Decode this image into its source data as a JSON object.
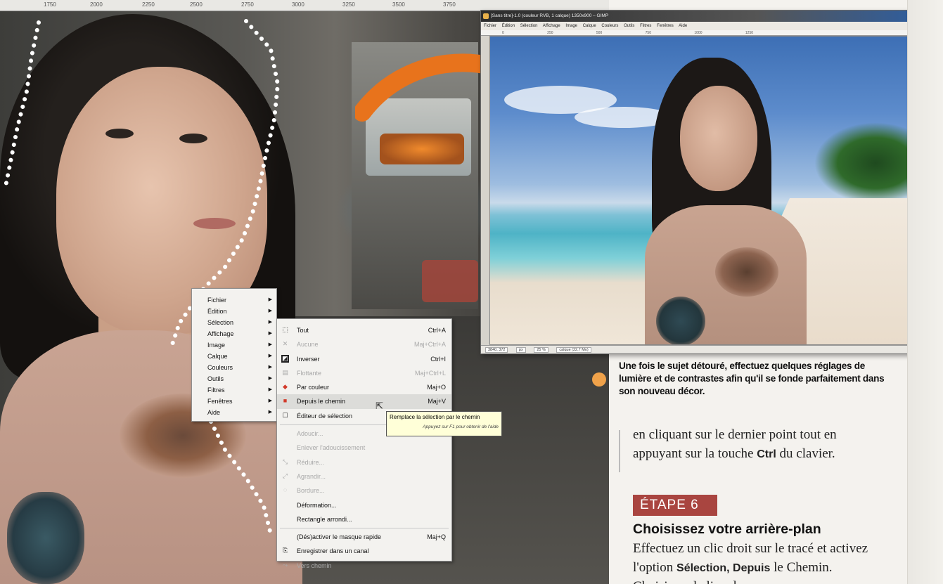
{
  "left_ruler": {
    "ticks": [
      "1750",
      "2000",
      "2250",
      "2500",
      "2750",
      "3000",
      "3250",
      "3500",
      "3750"
    ]
  },
  "context_menu": {
    "items": [
      {
        "label": "Fichier"
      },
      {
        "label": "Édition"
      },
      {
        "label": "Sélection"
      },
      {
        "label": "Affichage"
      },
      {
        "label": "Image"
      },
      {
        "label": "Calque"
      },
      {
        "label": "Couleurs"
      },
      {
        "label": "Outils"
      },
      {
        "label": "Filtres"
      },
      {
        "label": "Fenêtres"
      },
      {
        "label": "Aide"
      }
    ]
  },
  "selection_submenu": {
    "items": [
      {
        "label": "Tout",
        "shortcut": "Ctrl+A",
        "icon": "select-all-icon",
        "disabled": false
      },
      {
        "label": "Aucune",
        "shortcut": "Maj+Ctrl+A",
        "icon": "select-none-icon",
        "disabled": true
      },
      {
        "label": "Inverser",
        "shortcut": "Ctrl+I",
        "icon": "invert-icon",
        "disabled": false
      },
      {
        "label": "Flottante",
        "shortcut": "Maj+Ctrl+L",
        "icon": "float-icon",
        "disabled": true
      },
      {
        "label": "Par couleur",
        "shortcut": "Maj+O",
        "icon": "by-color-icon",
        "disabled": false
      },
      {
        "label": "Depuis le chemin",
        "shortcut": "Maj+V",
        "icon": "from-path-icon",
        "disabled": false,
        "hover": true
      },
      {
        "label": "Éditeur de sélection",
        "shortcut": "",
        "icon": "selection-editor-icon",
        "disabled": false
      },
      {
        "sep": true
      },
      {
        "label": "Adoucir...",
        "shortcut": "",
        "icon": "",
        "disabled": true
      },
      {
        "label": "Enlever l'adoucissement",
        "shortcut": "",
        "icon": "",
        "disabled": true
      },
      {
        "label": "Réduire...",
        "shortcut": "",
        "icon": "shrink-icon",
        "disabled": true
      },
      {
        "label": "Agrandir...",
        "shortcut": "",
        "icon": "grow-icon",
        "disabled": true
      },
      {
        "label": "Bordure...",
        "shortcut": "",
        "icon": "border-icon",
        "disabled": true
      },
      {
        "label": "Déformation...",
        "shortcut": "",
        "icon": "",
        "disabled": false
      },
      {
        "label": "Rectangle arrondi...",
        "shortcut": "",
        "icon": "",
        "disabled": false
      },
      {
        "sep": true
      },
      {
        "label": "(Dés)activer le masque rapide",
        "shortcut": "Maj+Q",
        "icon": "",
        "disabled": false
      },
      {
        "label": "Enregistrer dans un canal",
        "shortcut": "",
        "icon": "save-channel-icon",
        "disabled": false
      },
      {
        "label": "Vers chemin",
        "shortcut": "",
        "icon": "to-path-icon",
        "disabled": true
      }
    ]
  },
  "tooltip": {
    "text": "Remplace la sélection par le chemin",
    "hint": "Appuyez sur F1 pour obtenir de l'aide"
  },
  "gimp_window": {
    "title": "[Sans titre]-1.0 (couleur RVB, 1 calque) 1350x900 – GIMP",
    "menu": [
      "Fichier",
      "Édition",
      "Sélection",
      "Affichage",
      "Image",
      "Calque",
      "Couleurs",
      "Outils",
      "Filtres",
      "Fenêtres",
      "Aide"
    ],
    "ruler": [
      "0",
      "250",
      "500",
      "750",
      "1000",
      "1250"
    ],
    "status": {
      "coords": "3840, 372",
      "unit": "px",
      "zoom": "25 %",
      "info": "calque (22,7 Mo)"
    }
  },
  "article": {
    "caption": "Une fois le sujet détouré, effectuez quelques réglages de lumière et de contrastes afin qu'il se fonde parfaitement dans son nouveau décor.",
    "body_1": "en cliquant sur le dernier point tout en appuyant sur la touche",
    "body_1_key": "Ctrl",
    "body_1_end": "du clavier.",
    "step_badge": "ÉTAPE 6",
    "step_title": "Choisissez votre arrière-plan",
    "step_body_1": "Effectuez un clic droit sur le tracé et activez l'option",
    "step_body_key": "Sélection, Depuis",
    "step_body_2": "le Chemin. Choisissez le lieu dans"
  },
  "colors": {
    "accent": "#a94540",
    "arrow": "#e8731c"
  }
}
